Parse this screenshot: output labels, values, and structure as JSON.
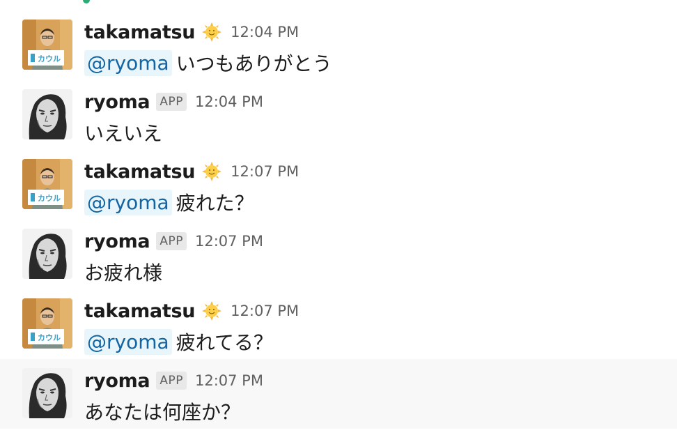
{
  "channel": {
    "messages": [
      {
        "author": "takamatsu",
        "avatar": "takamatsu-avatar",
        "status_emoji": "sun-with-face-icon",
        "app_badge": null,
        "time": "12:04 PM",
        "mention": "@ryoma",
        "text": "いつもありがとう"
      },
      {
        "author": "ryoma",
        "avatar": "ryoma-avatar",
        "status_emoji": null,
        "app_badge": "APP",
        "time": "12:04 PM",
        "mention": null,
        "text": "いえいえ"
      },
      {
        "author": "takamatsu",
        "avatar": "takamatsu-avatar",
        "status_emoji": "sun-with-face-icon",
        "app_badge": null,
        "time": "12:07 PM",
        "mention": "@ryoma",
        "text": "疲れた？"
      },
      {
        "author": "ryoma",
        "avatar": "ryoma-avatar",
        "status_emoji": null,
        "app_badge": "APP",
        "time": "12:07 PM",
        "mention": null,
        "text": "お疲れ様"
      },
      {
        "author": "takamatsu",
        "avatar": "takamatsu-avatar",
        "status_emoji": "sun-with-face-icon",
        "app_badge": null,
        "time": "12:07 PM",
        "mention": "@ryoma",
        "text": "疲れてる？"
      },
      {
        "author": "ryoma",
        "avatar": "ryoma-avatar",
        "status_emoji": null,
        "app_badge": "APP",
        "time": "12:07 PM",
        "mention": null,
        "text": "あなたは何座か？"
      }
    ]
  },
  "avatar_sign_text": "カウル",
  "colors": {
    "mention_text": "#1264a3",
    "mention_bg": "#e8f5fa",
    "presence": "#2bac76",
    "hover_bg": "#f8f8f8"
  }
}
